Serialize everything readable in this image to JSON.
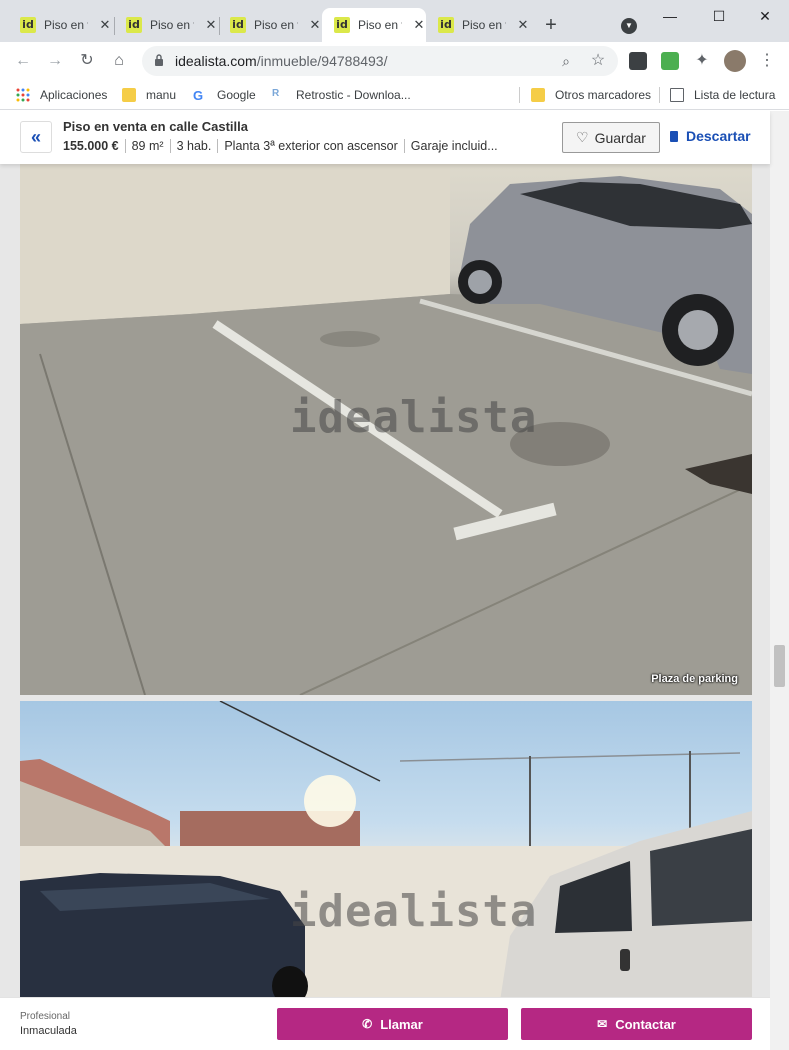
{
  "browser": {
    "tabs": [
      {
        "title": "Piso en venta en calle Castilla",
        "active": false
      },
      {
        "title": "Piso en venta en calle Castilla",
        "active": false
      },
      {
        "title": "Piso en venta en calle Castilla",
        "active": false
      },
      {
        "title": "Piso en venta en calle Castilla",
        "active": true
      },
      {
        "title": "Piso en venta en calle Castilla",
        "active": false
      }
    ],
    "favicon_text": "id",
    "url_host": "idealista.com",
    "url_path": "/inmueble/94788493/"
  },
  "bookmarks": {
    "items": [
      "Aplicaciones",
      "manu",
      "Google",
      "Retrostic - Downloa..."
    ],
    "other": "Otros marcadores",
    "reading_list": "Lista de lectura"
  },
  "listing": {
    "title": "Piso en venta en calle Castilla",
    "price": "155.000 €",
    "area": "89 m²",
    "rooms": "3 hab.",
    "floor": "Planta 3ª exterior con ascensor",
    "garage": "Garaje incluid...",
    "save_label": "Guardar",
    "discard_label": "Descartar"
  },
  "photos": {
    "watermark": "idealista",
    "caption_1": "Plaza de parking"
  },
  "contact": {
    "agent_type": "Profesional",
    "agent_name": "Inmaculada",
    "call_label": "Llamar",
    "contact_label": "Contactar"
  },
  "colors": {
    "brand_blue": "#1a4fb5",
    "cta_magenta": "#b52883",
    "favicon_yellow": "#dbe84a"
  }
}
